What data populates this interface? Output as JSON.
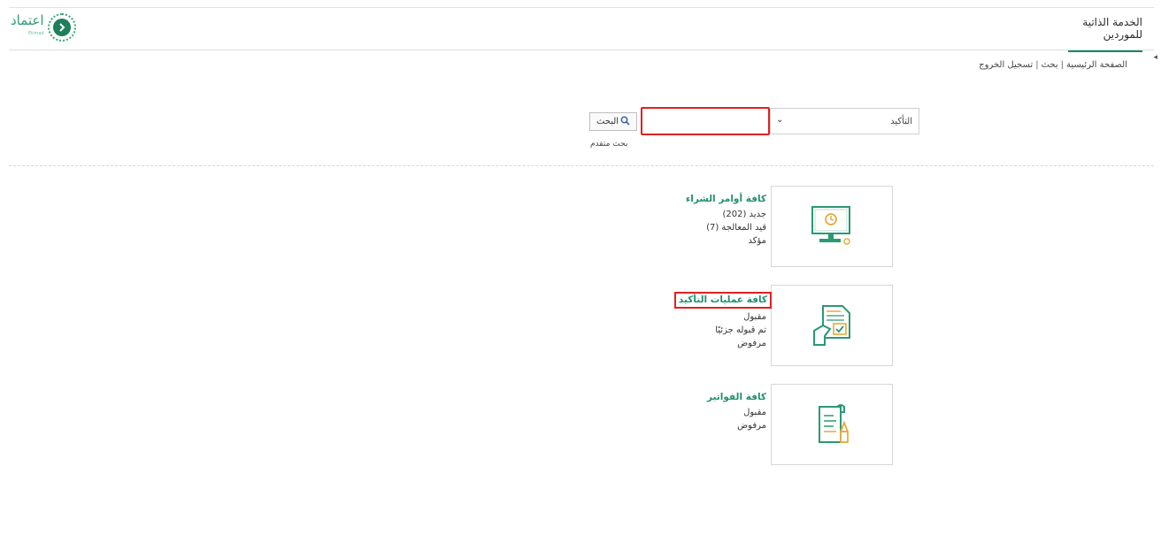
{
  "header": {
    "tab_title": "الخدمة الذاتية للموردين",
    "logo_text": "اعتماد",
    "logo_subtext": "Etimad"
  },
  "breadcrumb": {
    "home": "الصفحة الرئيسية",
    "search": "بحث",
    "logout": "تسجيل الخروج",
    "separator": "|"
  },
  "search": {
    "select_value": "التأكيد",
    "input_value": "",
    "button_label": "البحث",
    "advanced_link": "بحث متقدم"
  },
  "cards": [
    {
      "icon": "computer-purchase-order-icon",
      "title": "كافة أوامر الشراء",
      "items": [
        "جديد (202)",
        "قيد المعالجة (7)",
        "مؤكد"
      ]
    },
    {
      "icon": "confirmation-document-icon",
      "title": "كافة عمليات التأكيد",
      "items": [
        "مقبول",
        "تم قبوله جزئيًا",
        "مرفوض"
      ]
    },
    {
      "icon": "invoice-document-icon",
      "title": "كافة الفواتير",
      "items": [
        "مقبول",
        "مرفوض"
      ]
    }
  ],
  "colors": {
    "accent": "#21906b",
    "highlight": "#e0211f"
  }
}
